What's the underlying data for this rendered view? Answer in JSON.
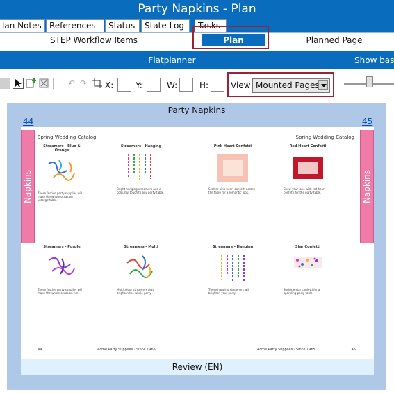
{
  "window": {
    "title": "Party Napkins - Plan"
  },
  "top_tabs": [
    {
      "label": "lan Notes"
    },
    {
      "label": "References"
    },
    {
      "label": "Status"
    },
    {
      "label": "State Log"
    },
    {
      "label": "Tasks"
    }
  ],
  "sub_tabs": {
    "workflow": "STEP Workflow Items",
    "plan": "Plan",
    "planned_page": "Planned Page"
  },
  "flatplanner": {
    "title": "Flatplanner",
    "show_label": "Show bas"
  },
  "toolbar": {
    "x_label": "X:",
    "y_label": "Y:",
    "w_label": "W:",
    "h_label": "H:",
    "view_label": "View",
    "view_selected": "Mounted Pages"
  },
  "spread": {
    "title": "Party Napkins",
    "left_page": "44",
    "right_page": "45",
    "side_label": "Napkins",
    "left_catalog": "Spring Wedding Catalog",
    "right_catalog": "Spring Wedding Catalog",
    "products": [
      {
        "name": "Streamers - Blue & Orange",
        "desc": "These festive party supplies will make the whole occasion unforgettable."
      },
      {
        "name": "Streamers - Hanging",
        "desc": "Bright hanging streamers add a colourful touch to any party table."
      },
      {
        "name": "Pink Heart Confetti",
        "desc": "Scatter pink heart confetti across the table for a romantic look."
      },
      {
        "name": "Red Heart Confetti",
        "desc": "Show your love with red heart confetti for the party table."
      },
      {
        "name": "Streamers - Purple",
        "desc": "These festive party supplies will make the whole occasion fun."
      },
      {
        "name": "Streamers - Multi",
        "desc": "Multicolour streamers that brighten the whole party."
      },
      {
        "name": "Streamers - Hanging",
        "desc": "These hanging streamers will brighten your party."
      },
      {
        "name": "Star Confetti",
        "desc": "Sprinkle star confetti for a sparkling party table."
      }
    ],
    "footer_left_num": "44",
    "footer_left_text": "Acme Party Supplies · Since 1965",
    "footer_right_text": "Acme Party Supplies · Since 1965",
    "footer_right_num": "45",
    "review_label": "Review (EN)"
  },
  "colors": {
    "brand_blue": "#0a6cbd",
    "highlight_red": "#9b2335",
    "napkins_pink": "#f07aa8",
    "spread_bg": "#afc8e8"
  }
}
